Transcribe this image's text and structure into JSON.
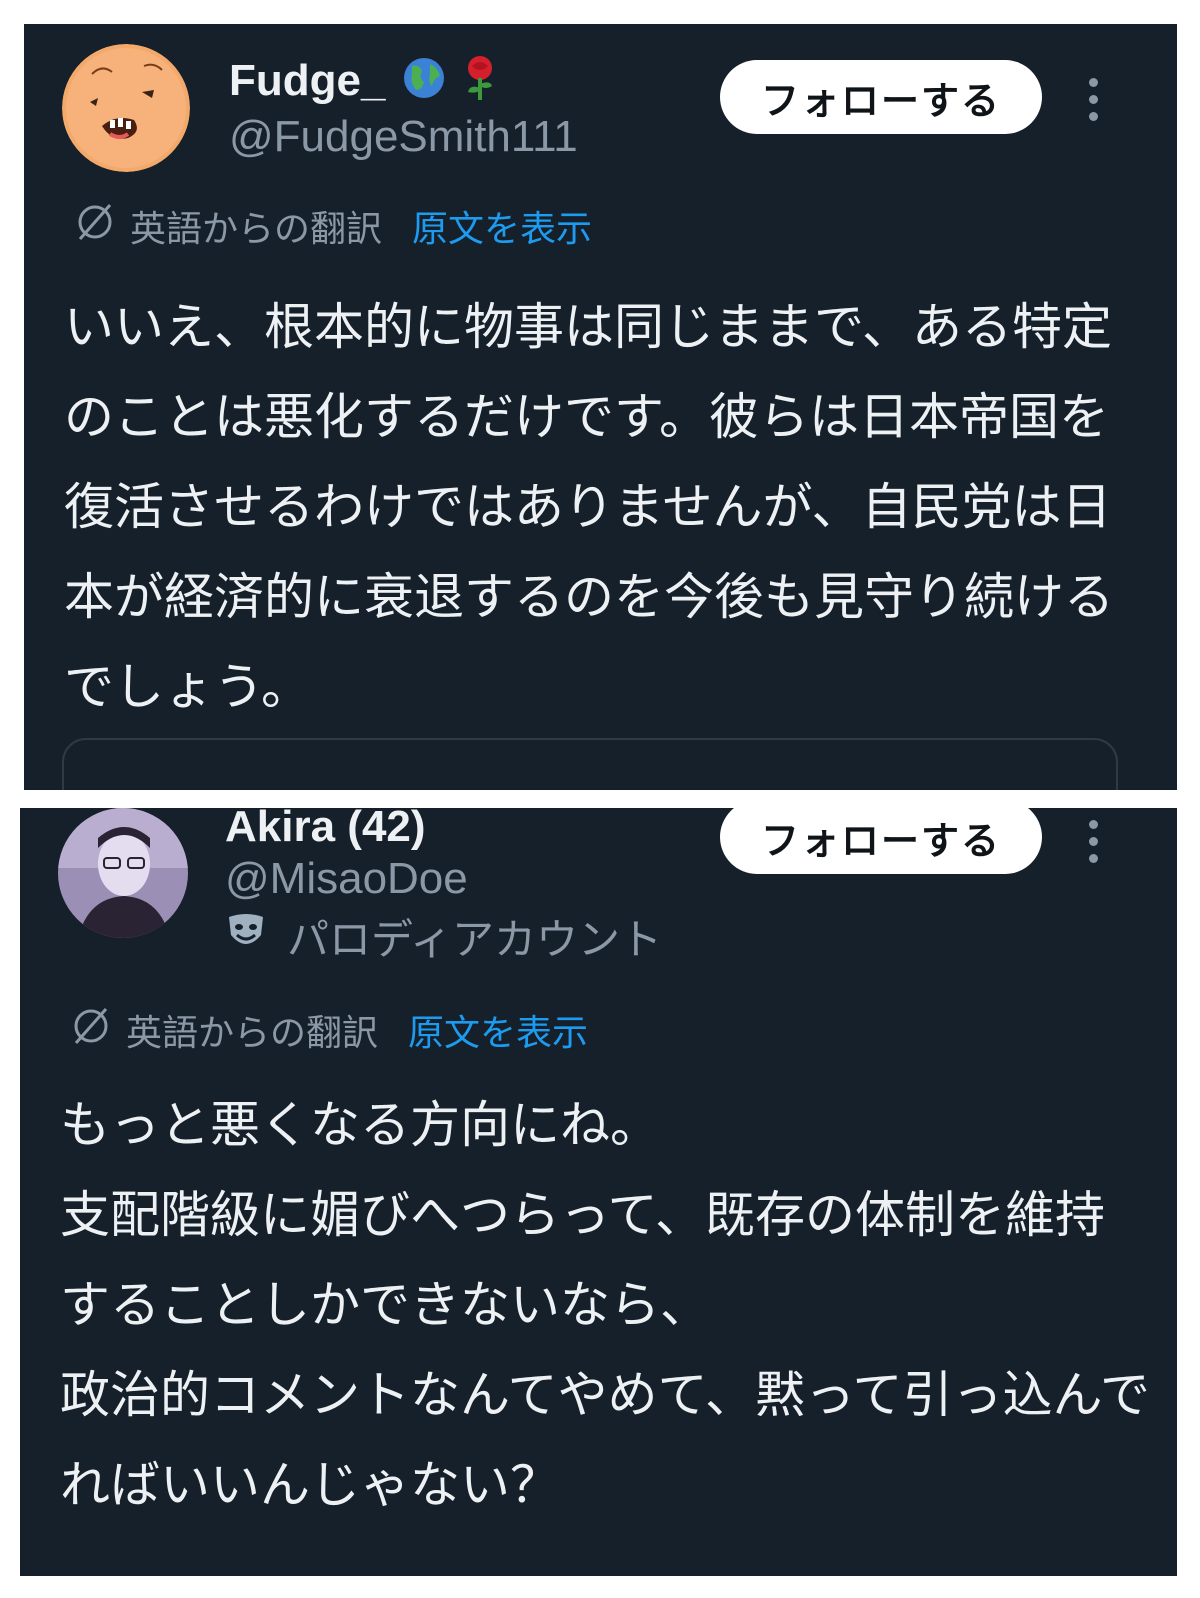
{
  "posts": [
    {
      "display_name": "Fudge_",
      "name_emojis": [
        "globe-icon",
        "rose-icon"
      ],
      "handle": "@FudgeSmith111",
      "follow_label": "フォローする",
      "translation_note": "英語からの翻訳",
      "show_original_label": "原文を表示",
      "text": "いいえ、根本的に物事は同じままで、ある特定のことは悪化するだけです。彼らは日本帝国を復活させるわけではありませんが、自民党は日本が経済的に衰退するのを今後も見守り続けるでしょう。"
    },
    {
      "display_name": "Akira (42)",
      "handle": "@MisaoDoe",
      "parody_label": "パロディアカウント",
      "follow_label": "フォローする",
      "translation_note": "英語からの翻訳",
      "show_original_label": "原文を表示",
      "text": "もっと悪くなる方向にね。\n支配階級に媚びへつらって、既存の体制を維持することしかできないなら、\n政治的コメントなんてやめて、黙って引っ込んでればいいんじゃない？"
    }
  ],
  "colors": {
    "card_bg": "#16202b",
    "text_primary": "#eef1f3",
    "text_secondary": "#8b98a5",
    "link": "#1d9bf0",
    "button_bg": "#ffffff"
  }
}
